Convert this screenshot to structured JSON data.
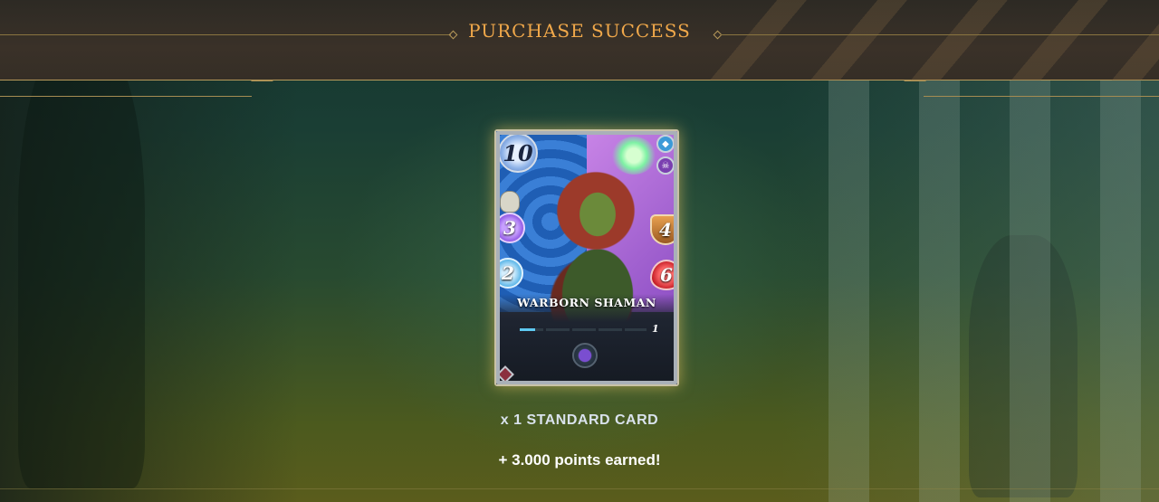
{
  "header": {
    "title": "PURCHASE SUCCESS"
  },
  "card": {
    "name": "WARBORN SHAMAN",
    "mana": "10",
    "magic": "3",
    "speed": "2",
    "armor": "4",
    "health": "6",
    "level": "1",
    "level_progress": 0.12,
    "elements": [
      "water-icon",
      "death-icon"
    ],
    "edition_icon": "death-splinter-icon",
    "rarity_icon": "common-rarity-icon"
  },
  "reward": {
    "quantity_label": "x 1 STANDARD CARD",
    "points_label": "+ 3.000 points earned!"
  },
  "colors": {
    "title": "#f0a84a",
    "accent_gold": "#b89a5a",
    "level_fill": "#5ec8f0"
  }
}
